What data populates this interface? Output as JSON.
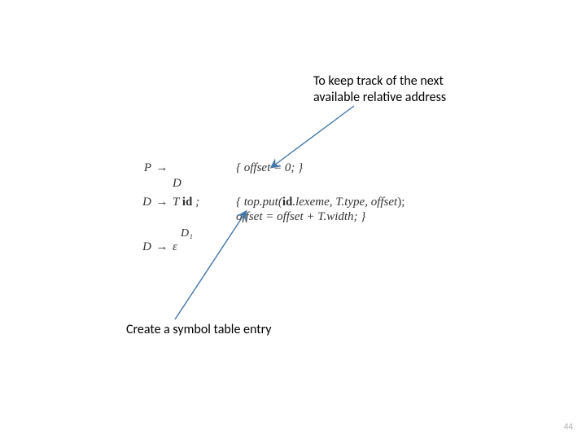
{
  "notes": {
    "top_line1": "To keep track of the next",
    "top_line2": "available relative address",
    "bottom": "Create a symbol table entry"
  },
  "page_number": "44",
  "sdt": {
    "P": "P",
    "D": "D",
    "arrow": "→",
    "T": "T",
    "id": "id",
    "semi": ";",
    "D1": "D₁",
    "eps": "ε",
    "rule1_action": "{  offset = 0;  }",
    "rule2_action_l1a": "{  top.put(",
    "rule2_action_l1b": ".lexeme,  T.type,  offset",
    "rule2_action_l1c": ");",
    "rule2_action_l2": "offset  =  offset + T.width; }"
  }
}
